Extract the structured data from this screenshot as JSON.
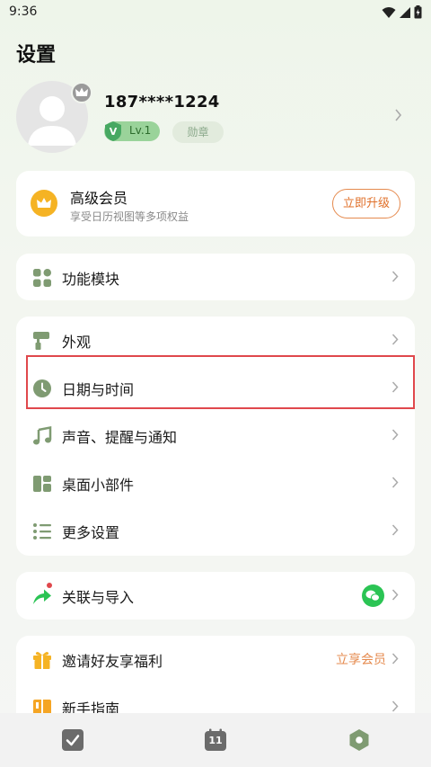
{
  "status_bar": {
    "time": "9:36"
  },
  "page": {
    "title": "设置"
  },
  "profile": {
    "phone": "187****1224",
    "level": "Lv.1",
    "medal": "勋章"
  },
  "premium": {
    "title": "高级会员",
    "subtitle": "享受日历视图等多项权益",
    "button": "立即升级"
  },
  "modules": {
    "label": "功能模块"
  },
  "settings": {
    "appearance": "外观",
    "datetime": "日期与时间",
    "sound": "声音、提醒与通知",
    "widgets": "桌面小部件",
    "more": "更多设置"
  },
  "link": {
    "label": "关联与导入"
  },
  "invite": {
    "label": "邀请好友享福利",
    "right_text": "立享会员",
    "guide": "新手指南"
  },
  "bottom_nav": {
    "calendar_day": "11"
  },
  "colors": {
    "accent_green": "#7f9b72",
    "premium_orange": "#e0702a",
    "highlight_red": "#e0484c",
    "wechat_green": "#2bc454"
  }
}
